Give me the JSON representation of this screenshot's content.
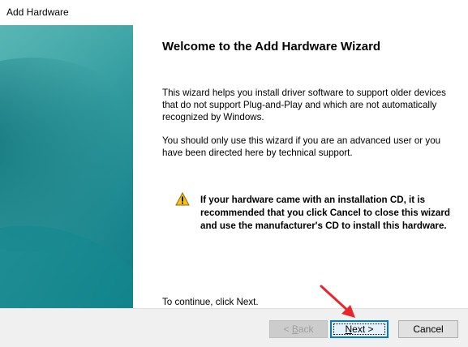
{
  "window": {
    "title": "Add Hardware"
  },
  "wizard": {
    "heading": "Welcome to the Add Hardware Wizard",
    "paragraph1": "This wizard helps you install driver software to support older devices that do not support Plug-and-Play and which are not automatically recognized by Windows.",
    "paragraph2": "You should only use this wizard if you are an advanced user or you have been directed here by technical support.",
    "warning": "If your hardware came with an installation CD, it is recommended that you click Cancel to close this wizard and use the manufacturer's CD to install this hardware.",
    "continue_text": "To continue, click Next."
  },
  "buttons": {
    "back_prefix": "< ",
    "back_accel": "B",
    "back_rest": "ack",
    "back_enabled": false,
    "next_accel": "N",
    "next_rest": "ext >",
    "cancel": "Cancel"
  },
  "icons": {
    "warning": "warning-triangle-icon",
    "annotation": "red-arrow-annotation"
  },
  "colors": {
    "banner": "#1e8d93",
    "focus": "#0078d7",
    "warning_fill": "#f7c21a",
    "annotation": "#e8262b"
  }
}
